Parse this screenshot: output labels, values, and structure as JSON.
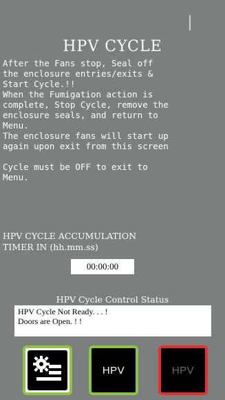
{
  "header": {
    "title": "HPV CYCLE"
  },
  "instructions": {
    "p1": "After the Fans stop, Seal off\nthe enclosure entries/exits &\nStart Cycle.!!\nWhen the Fumigation action is\ncomplete, Stop Cycle, remove the\nenclosure seals, and return to\nMenu.\nThe enclosure fans will start up\nagain upon exit from this screen\n\nCycle must be OFF to exit to\nMenu."
  },
  "timer": {
    "label": "HPV CYCLE ACCUMULATION\nTIMER IN (hh.mm.ss)",
    "value": "00:00:00"
  },
  "status": {
    "title": "HPV Cycle Control Status",
    "line1": "HPV  Cycle  Not  Ready. . . !",
    "line2": "Doors  are  Open.  !  !"
  },
  "buttons": {
    "menu_icon": "settings-menu-icon",
    "hpv_label": "HPV",
    "hpv_off_label": "HPV"
  },
  "colors": {
    "background": "#7b7f7f",
    "active_border": "#8cc63f",
    "inactive_border": "#e53030"
  }
}
